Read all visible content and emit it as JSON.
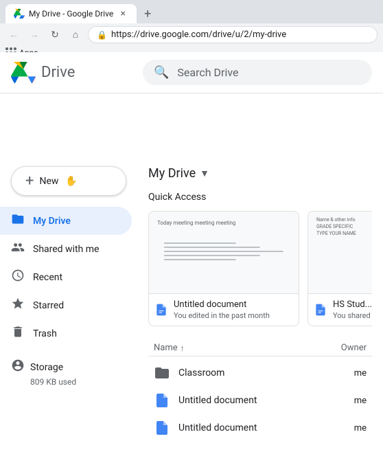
{
  "browser": {
    "tab": {
      "title": "My Drive - Google Drive",
      "favicon": "drive"
    },
    "address": "https://drive.google.com/drive/u/2/my-drive",
    "new_tab_label": "+",
    "close_label": "×",
    "apps_label": "Apps"
  },
  "header": {
    "app_name": "Drive",
    "search_placeholder": "Search Drive"
  },
  "sidebar": {
    "new_button": "New",
    "items": [
      {
        "id": "my-drive",
        "label": "My Drive",
        "icon": "folder",
        "active": true
      },
      {
        "id": "shared",
        "label": "Shared with me",
        "icon": "people"
      },
      {
        "id": "recent",
        "label": "Recent",
        "icon": "clock"
      },
      {
        "id": "starred",
        "label": "Starred",
        "icon": "star"
      },
      {
        "id": "trash",
        "label": "Trash",
        "icon": "trash"
      }
    ],
    "storage": {
      "label": "Storage",
      "used": "809 KB used"
    }
  },
  "content": {
    "title": "My Drive",
    "quick_access_label": "Quick Access",
    "files": [
      {
        "id": "untitled1",
        "name": "Untitled document",
        "meta": "You edited in the past month",
        "type": "doc",
        "has_preview": true,
        "preview_text": "Today meeting meeting meeting"
      },
      {
        "id": "hs-stud",
        "name": "HS Stud...",
        "meta": "You shared",
        "type": "doc",
        "has_preview": true,
        "preview_text": "Name & other info\nGRADE SPECIFIC\nTYPE YOUR NAME"
      }
    ],
    "list_header": {
      "name_col": "Name",
      "owner_col": "Owner"
    },
    "list_items": [
      {
        "id": "classroom",
        "name": "Classroom",
        "type": "folder",
        "owner": "me"
      },
      {
        "id": "untitled2",
        "name": "Untitled document",
        "type": "doc",
        "owner": "me"
      },
      {
        "id": "untitled3",
        "name": "Untitled document",
        "type": "doc",
        "owner": "me"
      }
    ]
  }
}
